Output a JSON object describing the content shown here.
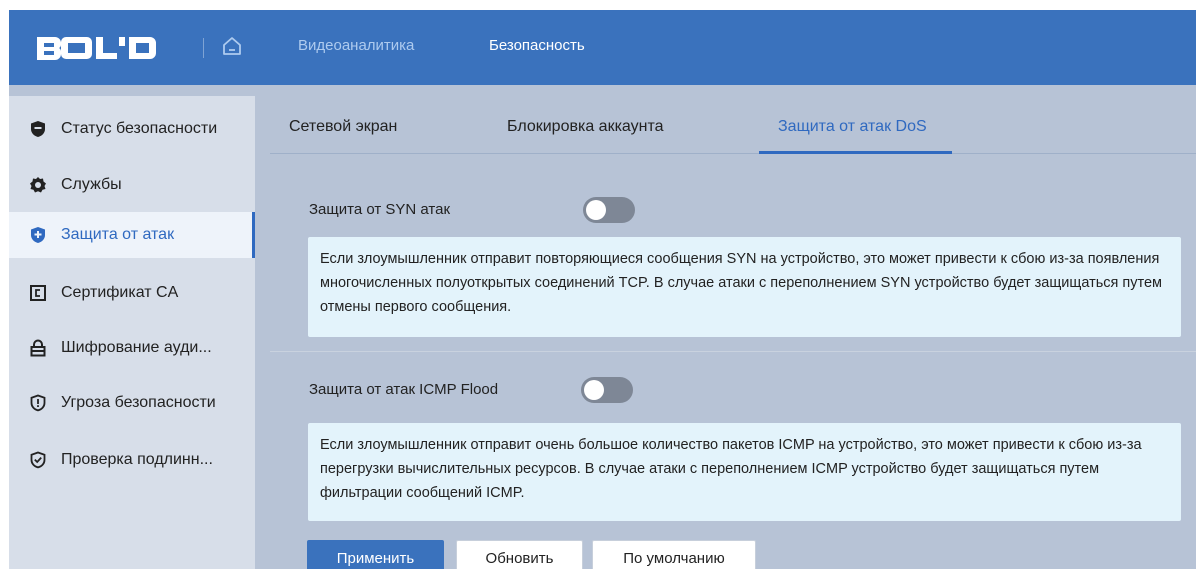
{
  "header": {
    "logo_text": "BOLID",
    "nav": [
      {
        "label": "Видеоаналитика",
        "active": false
      },
      {
        "label": "Безопасность",
        "active": true
      }
    ]
  },
  "sidebar": {
    "items": [
      {
        "label": "Статус безопасности",
        "icon": "shield-icon",
        "active": false
      },
      {
        "label": "Службы",
        "icon": "gear-icon",
        "active": false
      },
      {
        "label": "Защита от атак",
        "icon": "shield-plus-icon",
        "active": true
      },
      {
        "label": "Сертификат CA",
        "icon": "certificate-icon",
        "active": false
      },
      {
        "label": "Шифрование ауди...",
        "icon": "lock-icon",
        "active": false
      },
      {
        "label": "Угроза безопасности",
        "icon": "shield-alert-icon",
        "active": false
      },
      {
        "label": "Проверка подлинн...",
        "icon": "shield-check-icon",
        "active": false
      }
    ]
  },
  "tabs": [
    {
      "label": "Сетевой экран",
      "active": false
    },
    {
      "label": "Блокировка аккаунта",
      "active": false
    },
    {
      "label": "Защита от атак DoS",
      "active": true
    }
  ],
  "syn": {
    "label": "Защита от SYN атак",
    "enabled": false,
    "info": "Если злоумышленник отправит повторяющиеся сообщения SYN на устройство, это может привести к сбою из-за появления многочисленных полуоткрытых соединений TCP. В случае атаки с переполнением SYN устройство будет защищаться путем отмены первого сообщения."
  },
  "icmp": {
    "label": "Защита от атак ICMP Flood",
    "enabled": false,
    "info": "Если злоумышленник отправит очень большое количество пакетов ICMP на устройство, это может привести к сбою из-за перегрузки вычислительных ресурсов. В случае атаки с переполнением ICMP устройство будет защищаться путем фильтрации сообщений ICMP."
  },
  "buttons": {
    "apply": "Применить",
    "refresh": "Обновить",
    "default": "По умолчанию"
  },
  "colors": {
    "accent": "#3a72bd",
    "active_text": "#2f69c0",
    "page_bg": "#b7c3d6",
    "info_bg": "#e3f3fb"
  }
}
